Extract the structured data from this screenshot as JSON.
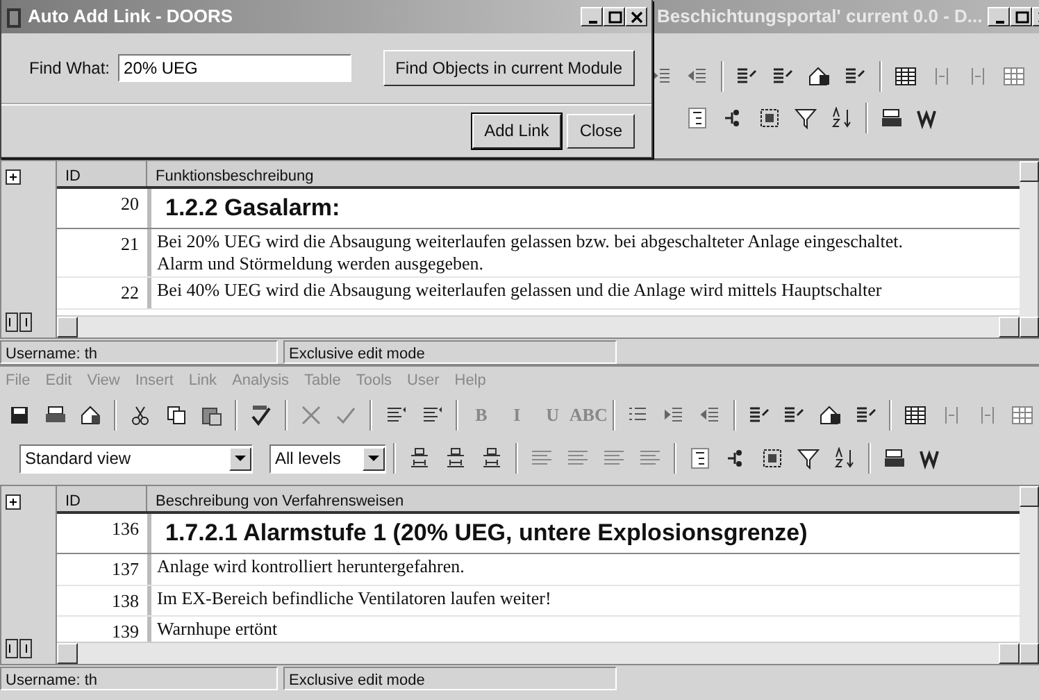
{
  "dialog": {
    "title": "Auto Add Link - DOORS",
    "find_label": "Find What:",
    "find_value": "20% UEG",
    "find_button": "Find Objects in current Module",
    "buttons": [
      "Add Link",
      "Close"
    ]
  },
  "back_window": {
    "title": "Beschichtungsportal' current 0.0 - D..."
  },
  "top_module": {
    "columns": [
      "ID",
      "Funktionsbeschreibung"
    ],
    "rows": [
      {
        "id": "20",
        "kind": "heading",
        "text": "1.2.2 Gasalarm:"
      },
      {
        "id": "21",
        "kind": "body",
        "text": "Bei 20% UEG wird die Absaugung weiterlaufen gelassen bzw. bei abgeschalteter Anlage eingeschaltet. Alarm und Störmeldung werden ausgegeben."
      },
      {
        "id": "22",
        "kind": "body",
        "text": "Bei 40% UEG wird die Absaugung weiterlaufen gelassen und die Anlage wird mittels Hauptschalter"
      }
    ],
    "status": [
      "Username: th",
      "Exclusive edit mode"
    ]
  },
  "bottom_window": {
    "menu": [
      "File",
      "Edit",
      "View",
      "Insert",
      "Link",
      "Analysis",
      "Table",
      "Tools",
      "User",
      "Help"
    ],
    "format_buttons": [
      "B",
      "I",
      "U",
      "ABC"
    ],
    "view_select": "Standard view",
    "level_select": "All levels",
    "module": {
      "columns": [
        "ID",
        "Beschreibung von Verfahrensweisen"
      ],
      "rows": [
        {
          "id": "136",
          "kind": "heading",
          "text": "1.7.2.1 Alarmstufe 1 (20% UEG, untere Explosionsgrenze)"
        },
        {
          "id": "137",
          "kind": "body",
          "text": "Anlage wird kontrolliert heruntergefahren."
        },
        {
          "id": "138",
          "kind": "body",
          "text": "Im EX-Bereich befindliche Ventilatoren laufen weiter!"
        },
        {
          "id": "139",
          "kind": "body",
          "text": "Warnhupe ertönt"
        }
      ],
      "status": [
        "Username: th",
        "Exclusive edit mode"
      ]
    }
  }
}
